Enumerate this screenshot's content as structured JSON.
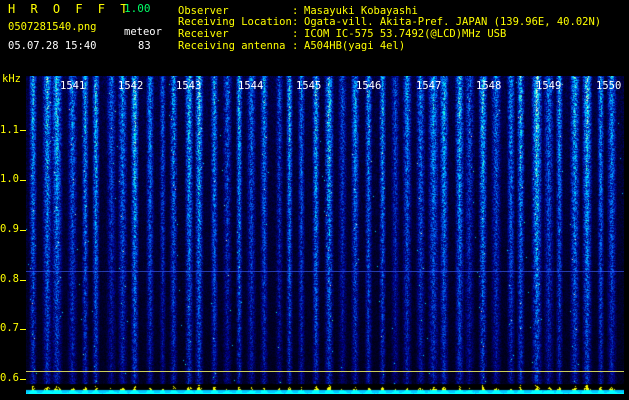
{
  "app": {
    "name": "H R O F F T",
    "version": "1.00"
  },
  "file": {
    "name": "0507281540.png",
    "datetime": "05.07.28 15:40"
  },
  "meteor": {
    "label": "meteor",
    "count": "83"
  },
  "info": [
    {
      "key": "Observer",
      "sep": ":",
      "value": "Masayuki Kobayashi"
    },
    {
      "key": "Receiving Location",
      "sep": ":",
      "value": "Ogata-vill. Akita-Pref. JAPAN (139.96E, 40.02N)"
    },
    {
      "key": "Receiver",
      "sep": ":",
      "value": "ICOM IC-575 53.7492(@LCD)MHz USB"
    },
    {
      "key": "Receiving antenna",
      "sep": ":",
      "value": "A504HB(yagi 4el)"
    }
  ],
  "axis": {
    "unit": "kHz",
    "y_ticks": [
      "1.1",
      "1.0",
      "0.9",
      "0.8",
      "0.7",
      "0.6"
    ],
    "x_ticks": [
      "1541",
      "1542",
      "1543",
      "1544",
      "1545",
      "1546",
      "1547",
      "1548",
      "1549",
      "1550"
    ]
  },
  "colors": {
    "title": "#ffff00",
    "label": "#00ff66",
    "text": "#ffffff",
    "marker": "#ffff00"
  }
}
